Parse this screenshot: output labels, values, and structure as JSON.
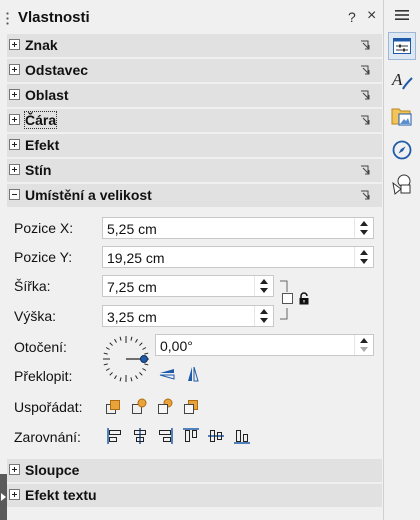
{
  "panel": {
    "title": "Vlastnosti",
    "help_label": "?",
    "close_label": "×"
  },
  "sections": {
    "znak": "Znak",
    "odstavec": "Odstavec",
    "oblast": "Oblast",
    "cara": "Čára",
    "efekt": "Efekt",
    "stin": "Stín",
    "umisteni": "Umístění a velikost",
    "sloupce": "Sloupce",
    "efekt_textu": "Efekt textu"
  },
  "position": {
    "x_label": "Pozice X:",
    "x_value": "5,25 cm",
    "y_label": "Pozice Y:",
    "y_value": "19,25 cm",
    "width_label": "Šířka:",
    "width_value": "7,25 cm",
    "height_label": "Výška:",
    "height_value": "3,25 cm",
    "rotation_label": "Otočení:",
    "rotation_value": "0,00°",
    "flip_label": "Překlopit:",
    "arrange_label": "Uspořádat:",
    "align_label": "Zarovnání:"
  },
  "sidebar_icons": [
    "properties-icon",
    "styles-icon",
    "gallery-icon",
    "navigator-icon",
    "shapes-icon"
  ],
  "colors": {
    "accent": "#1e5aa8",
    "orange": "#e8a33a"
  }
}
